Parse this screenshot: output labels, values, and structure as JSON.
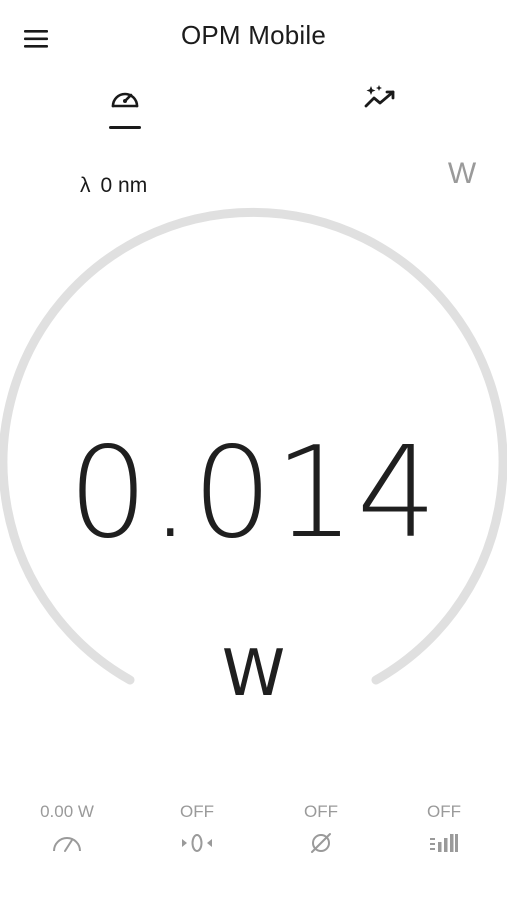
{
  "app_bar": {
    "title": "OPM Mobile",
    "menu_icon": "hamburger-menu-icon"
  },
  "tabs": [
    {
      "icon": "speedometer-icon",
      "selected": true
    },
    {
      "icon": "sparkle-chart-icon",
      "selected": false
    }
  ],
  "wavelength": {
    "symbol": "λ",
    "value": "0 nm"
  },
  "unit_toggle": {
    "label": "W"
  },
  "gauge": {
    "reading": "0.014",
    "unit": "W",
    "arc_color": "#e0e0e0"
  },
  "bottom_bar": [
    {
      "label": "0.00 W",
      "icon": "gauge-needle-icon"
    },
    {
      "label": "OFF",
      "icon": "zero-offset-icon"
    },
    {
      "label": "OFF",
      "icon": "diameter-icon"
    },
    {
      "label": "OFF",
      "icon": "signal-bars-icon"
    }
  ],
  "colors": {
    "text_primary": "#1a1a1a",
    "text_muted": "#9a9a9a",
    "background": "#ffffff"
  }
}
